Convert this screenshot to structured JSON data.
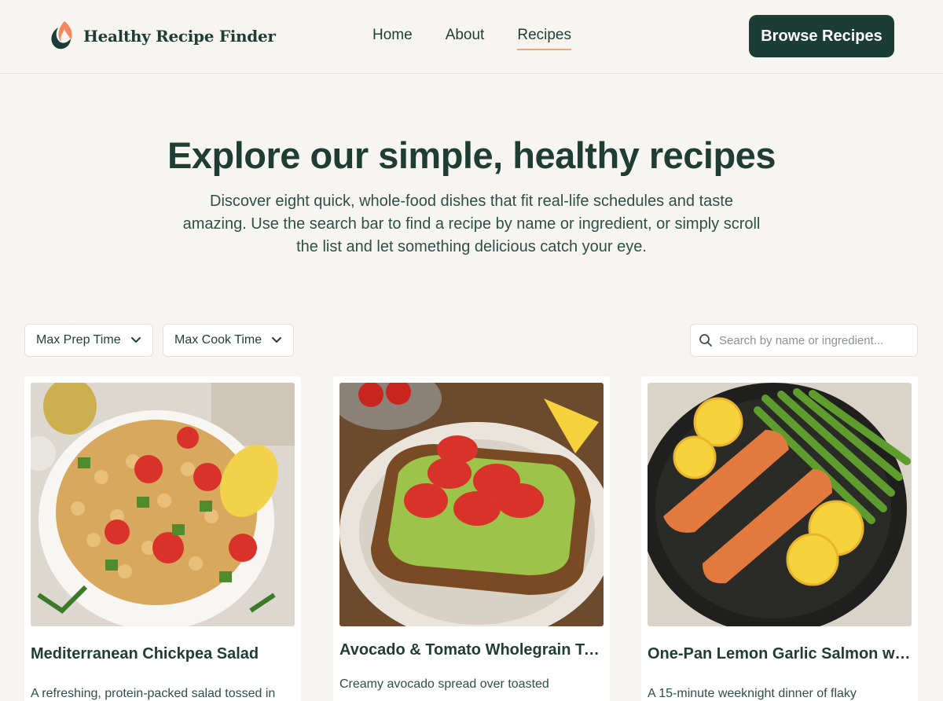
{
  "header": {
    "brand": "Healthy Recipe Finder",
    "nav": [
      {
        "label": "Home",
        "active": false
      },
      {
        "label": "About",
        "active": false
      },
      {
        "label": "Recipes",
        "active": true
      }
    ],
    "cta_label": "Browse Recipes"
  },
  "hero": {
    "title": "Explore our simple, healthy recipes",
    "subtitle": "Discover eight quick, whole-food dishes that fit real-life schedules and taste amazing. Use the search bar to find a recipe by name or ingredient, or simply scroll the list and let something delicious catch your eye."
  },
  "filters": {
    "prep_label": "Max Prep Time",
    "cook_label": "Max Cook Time",
    "search_placeholder": "Search by name or ingredient...",
    "search_value": ""
  },
  "recipes": [
    {
      "title": "Mediterranean Chickpea Salad",
      "description": "A refreshing, protein-packed salad tossed in",
      "image": "chickpea-salad-photo"
    },
    {
      "title": "Avocado & Tomato Wholegrain Toast",
      "description": "Creamy avocado spread over toasted",
      "image": "avocado-toast-photo"
    },
    {
      "title": "One-Pan Lemon Garlic Salmon with Asparagus",
      "description": "A 15-minute weeknight dinner of flaky",
      "image": "salmon-pan-photo"
    }
  ],
  "colors": {
    "background": "#f6f5f2",
    "primary": "#1b3d36",
    "accent": "#f2a37c",
    "card": "#ffffff"
  }
}
